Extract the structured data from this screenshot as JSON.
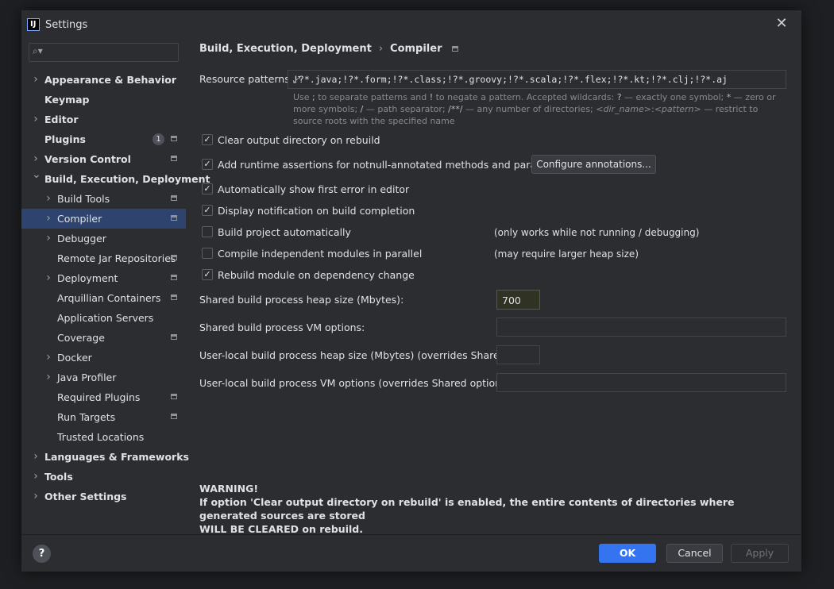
{
  "window": {
    "title": "Settings",
    "logo_text": "IJ",
    "close_glyph": "✕"
  },
  "search": {
    "icon": "search-icon",
    "value": "",
    "placeholder": ""
  },
  "sidebar": {
    "items": [
      {
        "label": "Appearance & Behavior",
        "indent": 0,
        "arrow": "right",
        "bold": true
      },
      {
        "label": "Keymap",
        "indent": 0,
        "arrow": "none",
        "bold": true
      },
      {
        "label": "Editor",
        "indent": 0,
        "arrow": "right",
        "bold": true
      },
      {
        "label": "Plugins",
        "indent": 0,
        "arrow": "none",
        "bold": true,
        "badge": "1",
        "gear": true
      },
      {
        "label": "Version Control",
        "indent": 0,
        "arrow": "right",
        "bold": true,
        "gear": true
      },
      {
        "label": "Build, Execution, Deployment",
        "indent": 0,
        "arrow": "down",
        "bold": true
      },
      {
        "label": "Build Tools",
        "indent": 1,
        "arrow": "right",
        "gear": true
      },
      {
        "label": "Compiler",
        "indent": 1,
        "arrow": "right",
        "gear": true,
        "selected": true
      },
      {
        "label": "Debugger",
        "indent": 1,
        "arrow": "right"
      },
      {
        "label": "Remote Jar Repositories",
        "indent": 1,
        "arrow": "none",
        "gear": true
      },
      {
        "label": "Deployment",
        "indent": 1,
        "arrow": "right",
        "gear": true
      },
      {
        "label": "Arquillian Containers",
        "indent": 1,
        "arrow": "none",
        "gear": true
      },
      {
        "label": "Application Servers",
        "indent": 1,
        "arrow": "none"
      },
      {
        "label": "Coverage",
        "indent": 1,
        "arrow": "none",
        "gear": true
      },
      {
        "label": "Docker",
        "indent": 1,
        "arrow": "right"
      },
      {
        "label": "Java Profiler",
        "indent": 1,
        "arrow": "right"
      },
      {
        "label": "Required Plugins",
        "indent": 1,
        "arrow": "none",
        "gear": true
      },
      {
        "label": "Run Targets",
        "indent": 1,
        "arrow": "none",
        "gear": true
      },
      {
        "label": "Trusted Locations",
        "indent": 1,
        "arrow": "none"
      },
      {
        "label": "Languages & Frameworks",
        "indent": 0,
        "arrow": "right",
        "bold": true
      },
      {
        "label": "Tools",
        "indent": 0,
        "arrow": "right",
        "bold": true
      },
      {
        "label": "Other Settings",
        "indent": 0,
        "arrow": "right",
        "bold": true
      }
    ]
  },
  "breadcrumb": {
    "part1": "Build, Execution, Deployment",
    "separator": "›",
    "part2": "Compiler"
  },
  "resource_patterns": {
    "label": "Resource patterns:",
    "value": "!?*.java;!?*.form;!?*.class;!?*.groovy;!?*.scala;!?*.flex;!?*.kt;!?*.clj;!?*.aj",
    "expand_glyph": "⤢",
    "hint": {
      "t1": "Use ",
      "k1": ";",
      "t2": " to separate patterns and ",
      "k2": "!",
      "t3": " to negate a pattern. Accepted wildcards: ",
      "k3": "?",
      "t4": " — exactly one symbol; ",
      "k4": "*",
      "t5": " — zero or more symbols; ",
      "k5": "/",
      "t6": " — path separator; ",
      "k6": "/**/",
      "t7": " — any number of directories; ",
      "i1": "<dir_name>",
      "t8": ":",
      "i2": "<pattern>",
      "t9": " — restrict to source roots with the specified name"
    }
  },
  "options": [
    {
      "label": "Clear output directory on rebuild",
      "checked": true,
      "mark": "✓"
    },
    {
      "label": "Add runtime assertions for notnull-annotated methods and parameters",
      "checked": true,
      "mark": "✓"
    },
    {
      "label": "Automatically show first error in editor",
      "checked": true,
      "mark": "✓"
    },
    {
      "label": "Display notification on build completion",
      "checked": true,
      "mark": "✓"
    },
    {
      "label": "Build project automatically",
      "checked": false,
      "mark": "",
      "note": "(only works while not running / debugging)"
    },
    {
      "label": "Compile independent modules in parallel",
      "checked": false,
      "mark": "",
      "note": "(may require larger heap size)"
    },
    {
      "label": "Rebuild module on dependency change",
      "checked": true,
      "mark": "✓"
    }
  ],
  "configure_button": "Configure annotations...",
  "fields": {
    "shared_heap_label": "Shared build process heap size (Mbytes):",
    "shared_heap_value": "700",
    "shared_vm_label": "Shared build process VM options:",
    "shared_vm_value": "",
    "local_heap_label": "User-local build process heap size (Mbytes) (overrides Shared size):",
    "local_heap_value": "",
    "local_vm_label": "User-local build process VM options (overrides Shared options):",
    "local_vm_value": ""
  },
  "warning": {
    "title": "WARNING!",
    "line1": "If option 'Clear output directory on rebuild' is enabled, the entire contents of directories where generated sources are stored",
    "line2": "WILL BE CLEARED on rebuild."
  },
  "footer": {
    "help": "?",
    "ok": "OK",
    "cancel": "Cancel",
    "apply": "Apply"
  },
  "colors": {
    "accent": "#3574f0",
    "selection": "#2e436e",
    "background": "#2b2d30",
    "heap_highlight": "#303224"
  }
}
